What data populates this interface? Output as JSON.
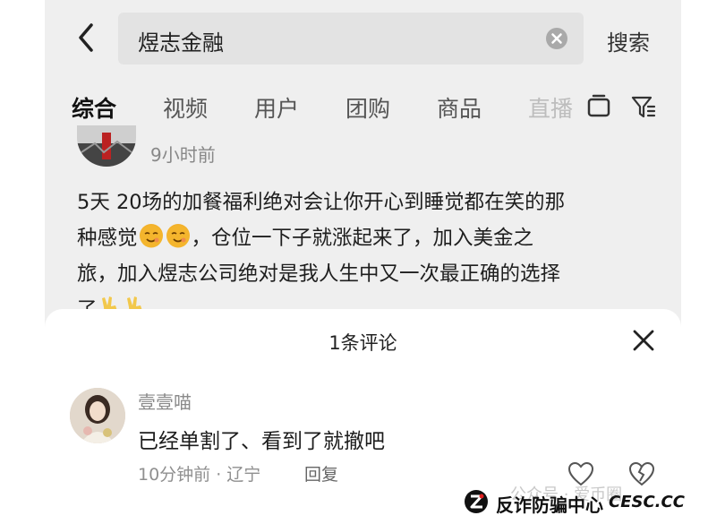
{
  "search": {
    "query": "煜志金融",
    "button_label": "搜索"
  },
  "tabs": [
    {
      "label": "综合"
    },
    {
      "label": "视频"
    },
    {
      "label": "用户"
    },
    {
      "label": "团购"
    },
    {
      "label": "商品"
    },
    {
      "label": "直播"
    }
  ],
  "post": {
    "time": "9小时前",
    "line1": "5天 20场的加餐福利绝对会让你开心到睡觉都在笑的那",
    "line2a": "种感觉",
    "line2b": "，仓位一下子就涨起来了，加入美金之",
    "line3": "旅，加入煜志公司绝对是我人生中又一次最正确的选择",
    "line4": "了"
  },
  "comments_sheet": {
    "title": "1条评论",
    "comment": {
      "username": "壹壹喵",
      "text": "已经单割了、看到了就撤吧",
      "meta": "10分钟前 · 辽宁",
      "reply_label": "回复"
    }
  },
  "watermark": {
    "gray": "公众号 · 爱币圈",
    "name": "反诈防骗中心",
    "domain": "CESC.CC"
  },
  "icons": [
    "back-arrow-icon",
    "clear-icon",
    "tv-icon",
    "filter-icon",
    "close-icon",
    "heart-icon",
    "broken-heart-icon",
    "emoji-icon",
    "victory-hand-icon"
  ]
}
